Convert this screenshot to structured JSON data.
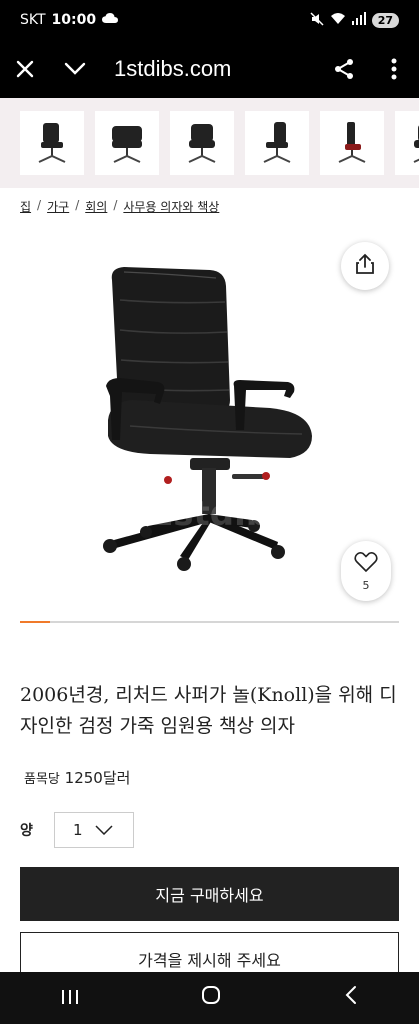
{
  "status_bar": {
    "carrier": "SKT",
    "time": "10:00",
    "battery": "27"
  },
  "browser": {
    "url": "1stdibs.com"
  },
  "thumbnails": {
    "count": 6
  },
  "breadcrumb": [
    {
      "label": "집"
    },
    {
      "label": "가구"
    },
    {
      "label": "회의"
    },
    {
      "label": "사무용 의자와 책상"
    }
  ],
  "breadcrumb_separator": "/",
  "product": {
    "image_watermark": "1stdibs",
    "like_count": "5",
    "gallery_progress": 0.08,
    "title": "2006년경, 리처드 사퍼가 놀(Knoll)을 위해 디자인한 검정 가죽 임원용 책상 의자",
    "price_prefix": "품목당",
    "price_value": "1250달러"
  },
  "quantity": {
    "label": "양",
    "value": "1"
  },
  "actions": {
    "buy_label": "지금 구매하세요",
    "offer_label": "가격을 제시해 주세요"
  },
  "colors": {
    "accent": "#f07a2a",
    "dark": "#222222"
  }
}
